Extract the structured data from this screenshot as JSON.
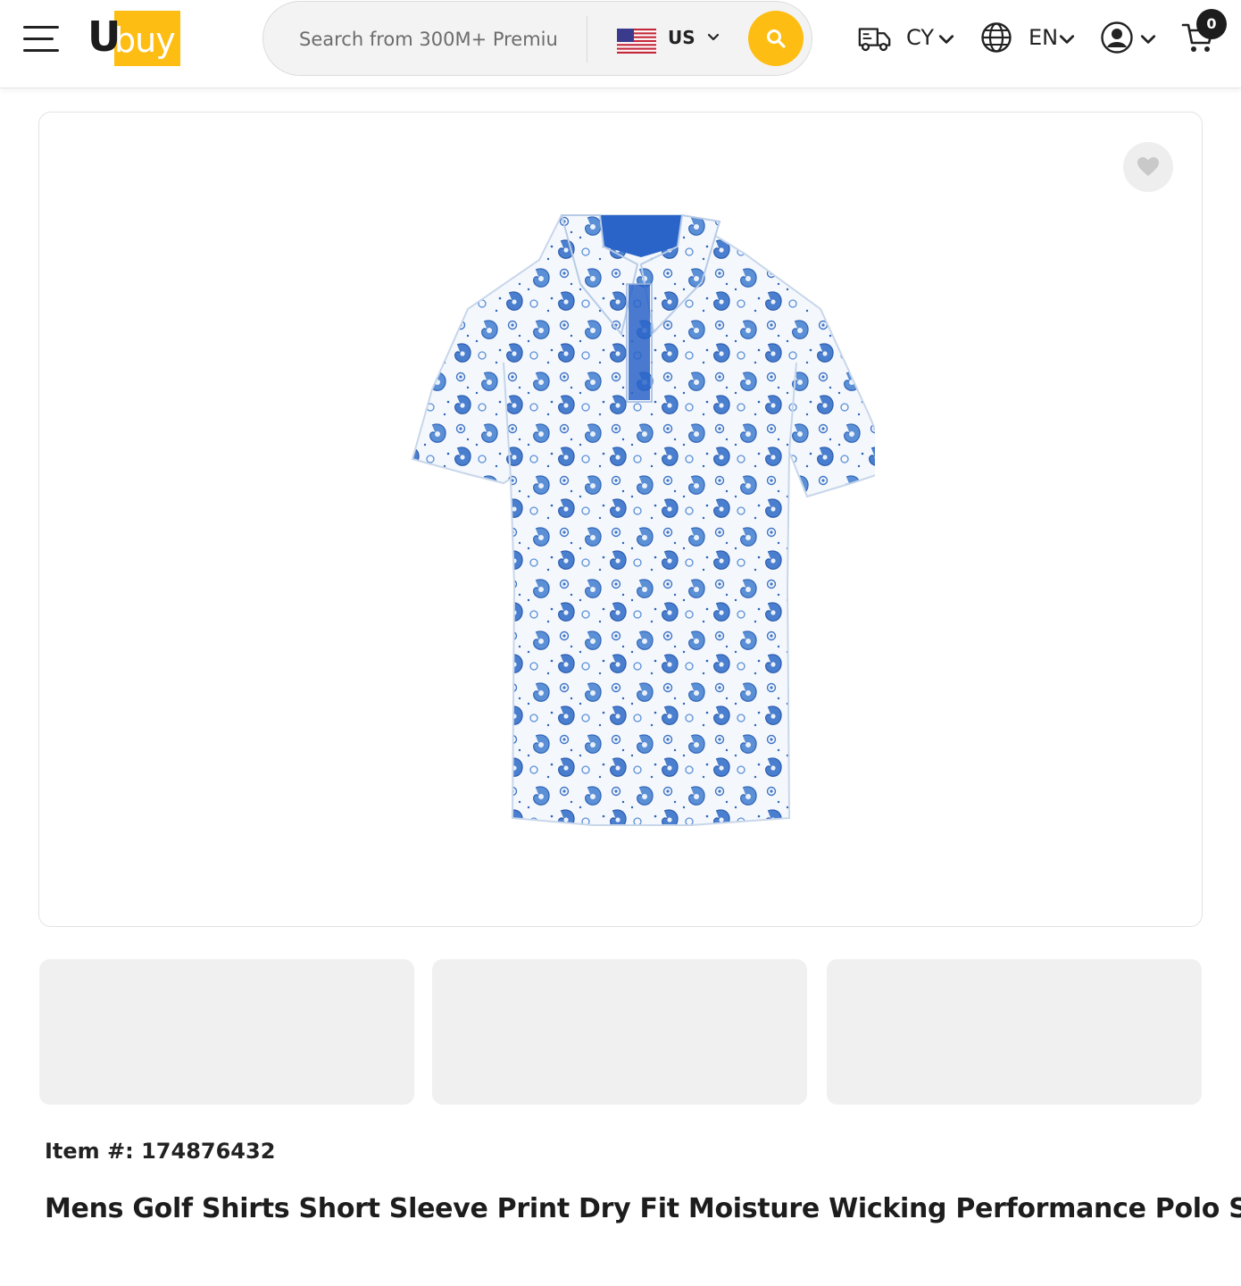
{
  "header": {
    "logo_text": "Ubuy",
    "search": {
      "placeholder": "Search from 300M+ Premiu"
    },
    "country": {
      "code": "US"
    },
    "shipping_currency": "CY",
    "language": "EN",
    "cart_count": "0",
    "icons": [
      "menu-icon",
      "us-flag-icon",
      "search-icon",
      "truck-icon",
      "globe-icon",
      "account-icon",
      "cart-icon",
      "chevron-down-icon"
    ],
    "accent_color": "#febd12"
  },
  "product": {
    "item_number": "Item #: 174876432",
    "title": "Mens Golf Shirts Short Sleeve Print Dry Fit Moisture Wicking Performance Polo Shirt",
    "image_alt": "Blue paisley print polo shirt",
    "thumbnail_count": 3
  }
}
